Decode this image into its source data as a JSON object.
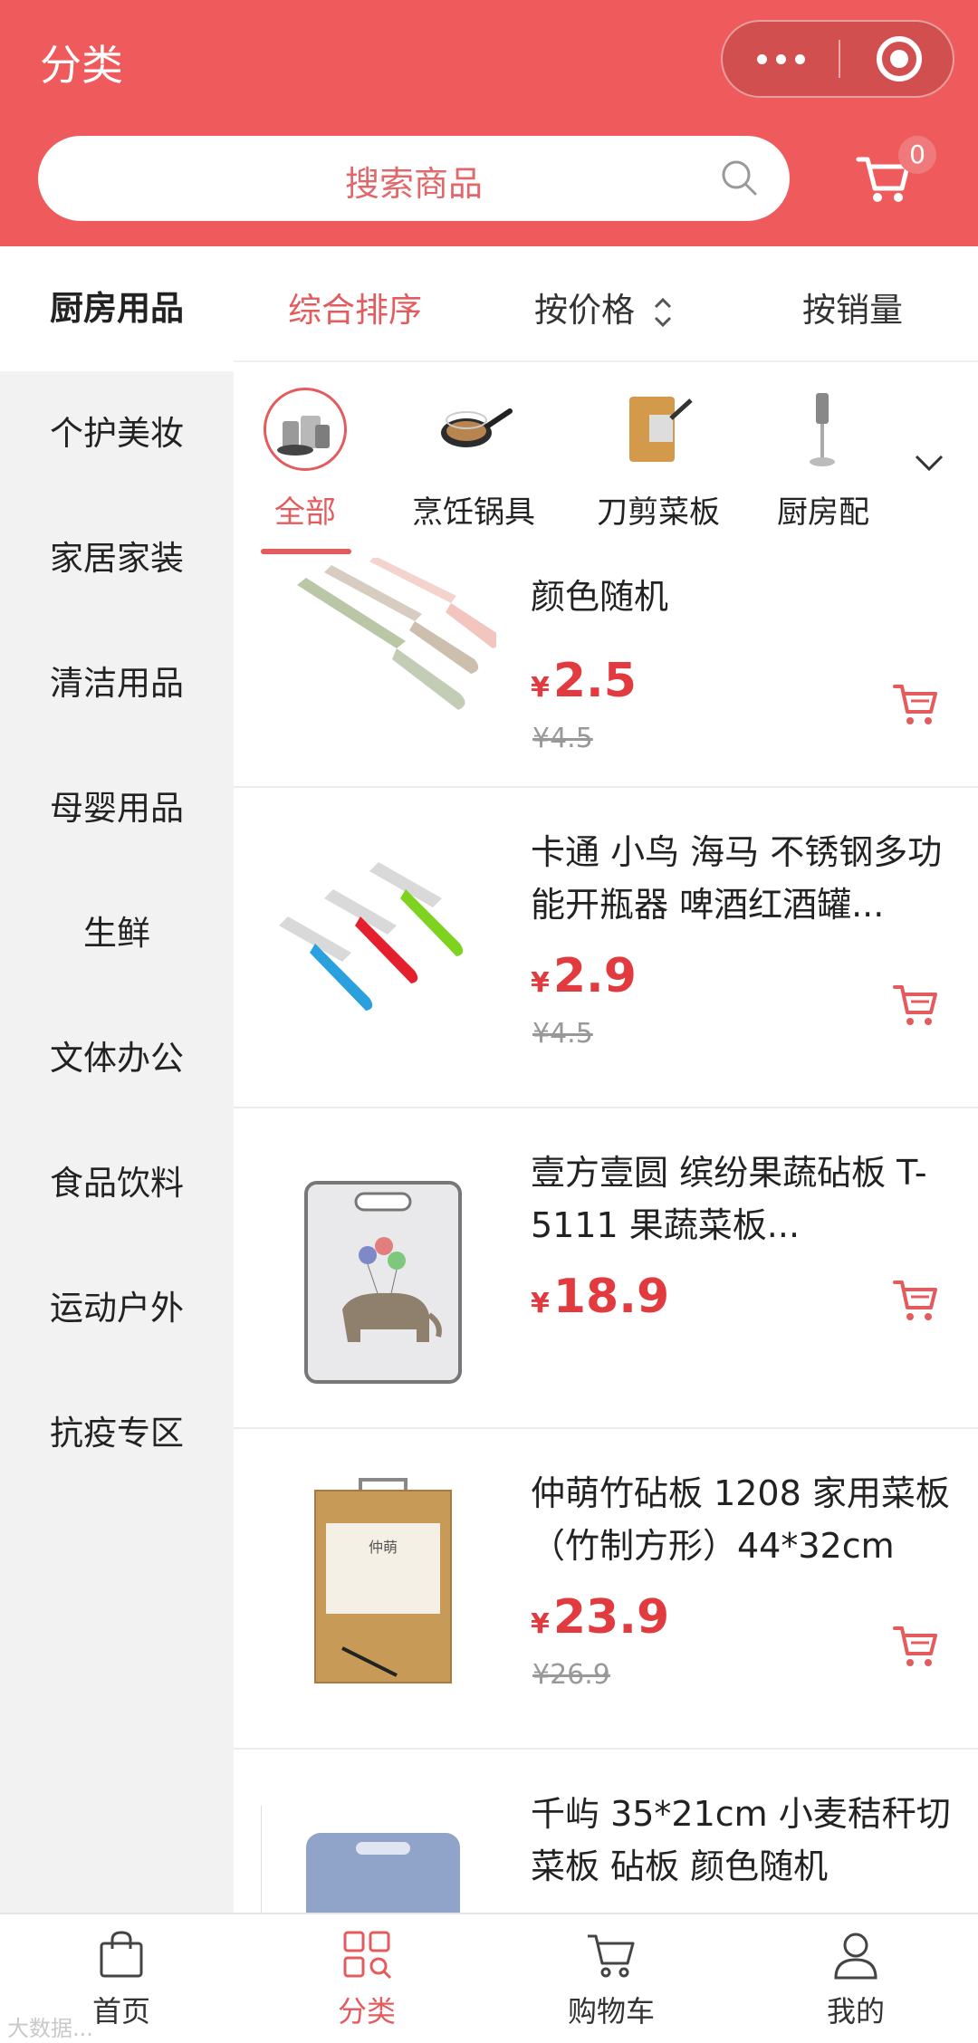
{
  "header": {
    "title": "分类",
    "search_placeholder": "搜索商品",
    "cart_badge": "0"
  },
  "sidebar": {
    "items": [
      {
        "label": "厨房用品",
        "active": true
      },
      {
        "label": "个护美妆"
      },
      {
        "label": "家居家装"
      },
      {
        "label": "清洁用品"
      },
      {
        "label": "母婴用品"
      },
      {
        "label": "生鲜"
      },
      {
        "label": "文体办公"
      },
      {
        "label": "食品饮料"
      },
      {
        "label": "运动户外"
      },
      {
        "label": "抗疫专区"
      }
    ]
  },
  "sort": {
    "overall": "综合排序",
    "price": "按价格",
    "sales": "按销量"
  },
  "categories": [
    {
      "label": "全部",
      "icon": "kitchenware-set-icon"
    },
    {
      "label": "烹饪锅具",
      "icon": "frying-pan-icon"
    },
    {
      "label": "刀剪菜板",
      "icon": "knife-board-icon"
    },
    {
      "label": "厨房配",
      "icon": "kitchen-utensils-icon"
    }
  ],
  "products": [
    {
      "title": "颜色随机",
      "currency": "¥",
      "price": "2.5",
      "old_price": "¥4.5",
      "image": "fruit-knife-set"
    },
    {
      "title": "卡通 小鸟 海马 不锈钢多功能开瓶器 啤酒红酒罐...",
      "currency": "¥",
      "price": "2.9",
      "old_price": "¥4.5",
      "image": "bottle-openers"
    },
    {
      "title": "壹方壹圆 缤纷果蔬砧板 T-5111 果蔬菜板...",
      "currency": "¥",
      "price": "18.9",
      "old_price": "",
      "image": "elephant-cutting-board"
    },
    {
      "title": "仲萌竹砧板 1208 家用菜板（竹制方形）44*32cm",
      "currency": "¥",
      "price": "23.9",
      "old_price": "¥26.9",
      "image": "bamboo-cutting-board",
      "image_text": "仲萌"
    },
    {
      "title": "千屿 35*21cm 小麦秸秆切菜板 砧板 颜色随机",
      "currency": "¥",
      "price": "",
      "old_price": "",
      "image": "wheat-straw-board"
    }
  ],
  "tabbar": [
    {
      "label": "首页",
      "icon": "shopping-bag-icon"
    },
    {
      "label": "分类",
      "icon": "category-grid-icon",
      "active": true
    },
    {
      "label": "购物车",
      "icon": "cart-icon"
    },
    {
      "label": "我的",
      "icon": "user-icon"
    }
  ],
  "watermark": "大数据..."
}
